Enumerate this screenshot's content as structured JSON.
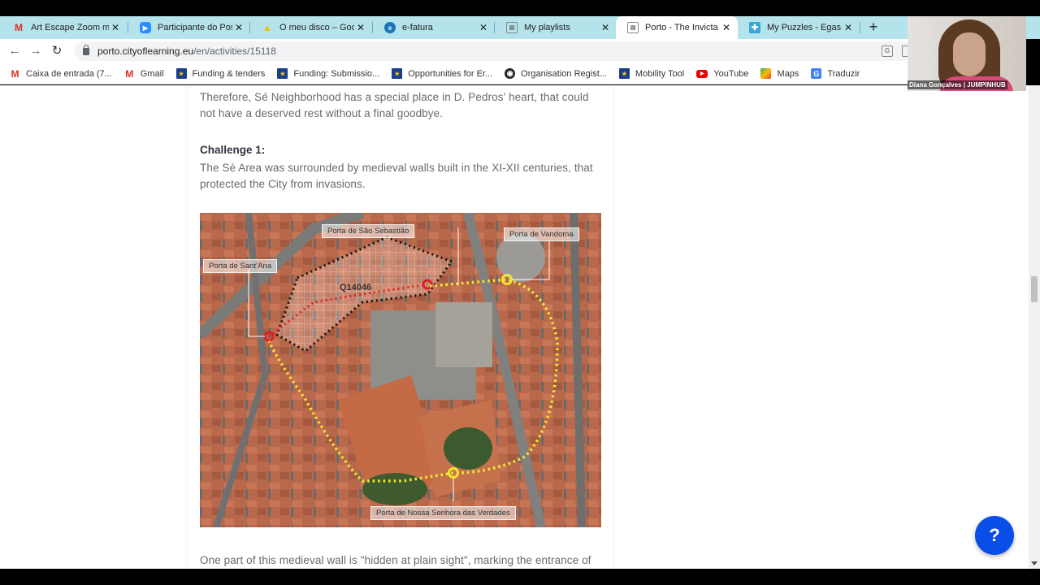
{
  "browser": {
    "tabs": [
      {
        "title": "Art Escape Zoom mee",
        "icon": "gmail-icon",
        "active": false
      },
      {
        "title": "Participante do Post -",
        "icon": "zoom-icon",
        "active": false
      },
      {
        "title": "O meu disco – Googl",
        "icon": "google-drive-icon",
        "active": false
      },
      {
        "title": "e-fatura",
        "icon": "e-fatura-icon",
        "active": false
      },
      {
        "title": "My playlists",
        "icon": "playlist-icon",
        "active": false
      },
      {
        "title": "Porto - The Invicta Ci",
        "icon": "playlist-icon",
        "active": true
      },
      {
        "title": "My Puzzles - Egas Mo",
        "icon": "puzzle-icon",
        "active": false
      }
    ],
    "close_glyph": "✕",
    "new_tab_glyph": "+",
    "url_host": "porto.cityoflearning.eu",
    "url_path": "/en/activities/15118",
    "nav": {
      "back": "←",
      "forward": "→",
      "reload": "↻"
    },
    "bookmarks": [
      {
        "label": "Caixa de entrada (7...",
        "icon": "gmail-icon"
      },
      {
        "label": "Gmail",
        "icon": "gmail-icon"
      },
      {
        "label": "Funding & tenders",
        "icon": "eu-flag-icon"
      },
      {
        "label": "Funding: Submissio...",
        "icon": "eu-flag-icon"
      },
      {
        "label": "Opportunities for Er...",
        "icon": "eu-flag-icon"
      },
      {
        "label": "Organisation Regist...",
        "icon": "globe-icon"
      },
      {
        "label": "Mobility Tool",
        "icon": "eu-flag-icon"
      },
      {
        "label": "YouTube",
        "icon": "youtube-icon"
      },
      {
        "label": "Maps",
        "icon": "maps-icon"
      },
      {
        "label": "Traduzir",
        "icon": "translate-icon"
      }
    ]
  },
  "content": {
    "intro_paragraph": "Therefore, Sé Neighborhood has a special place in D. Pedros’ heart, that could not have a deserved rest without a final goodbye.",
    "challenge_heading": "Challenge 1:",
    "challenge_text": "The Sé Area was surrounded by medieval walls built in the XI-XII centuries, that protected the City from invasions.",
    "map": {
      "labels": {
        "sao_sebastiao": "Porta de São Sebastião",
        "vandoma": "Porta de Vandoma",
        "sant_ana": "Porta de Sant’Ana",
        "nossa_senhora": "Porta de Nossa Senhora das Verdades"
      },
      "code": "Q14046"
    },
    "next_paragraph": "One part of this medieval wall is \"hidden at plain sight\", marking the entrance of"
  },
  "help_button": {
    "label": "?"
  },
  "video_overlay": {
    "participant_name": "Diana Gonçalves | JUMPINHUB"
  }
}
